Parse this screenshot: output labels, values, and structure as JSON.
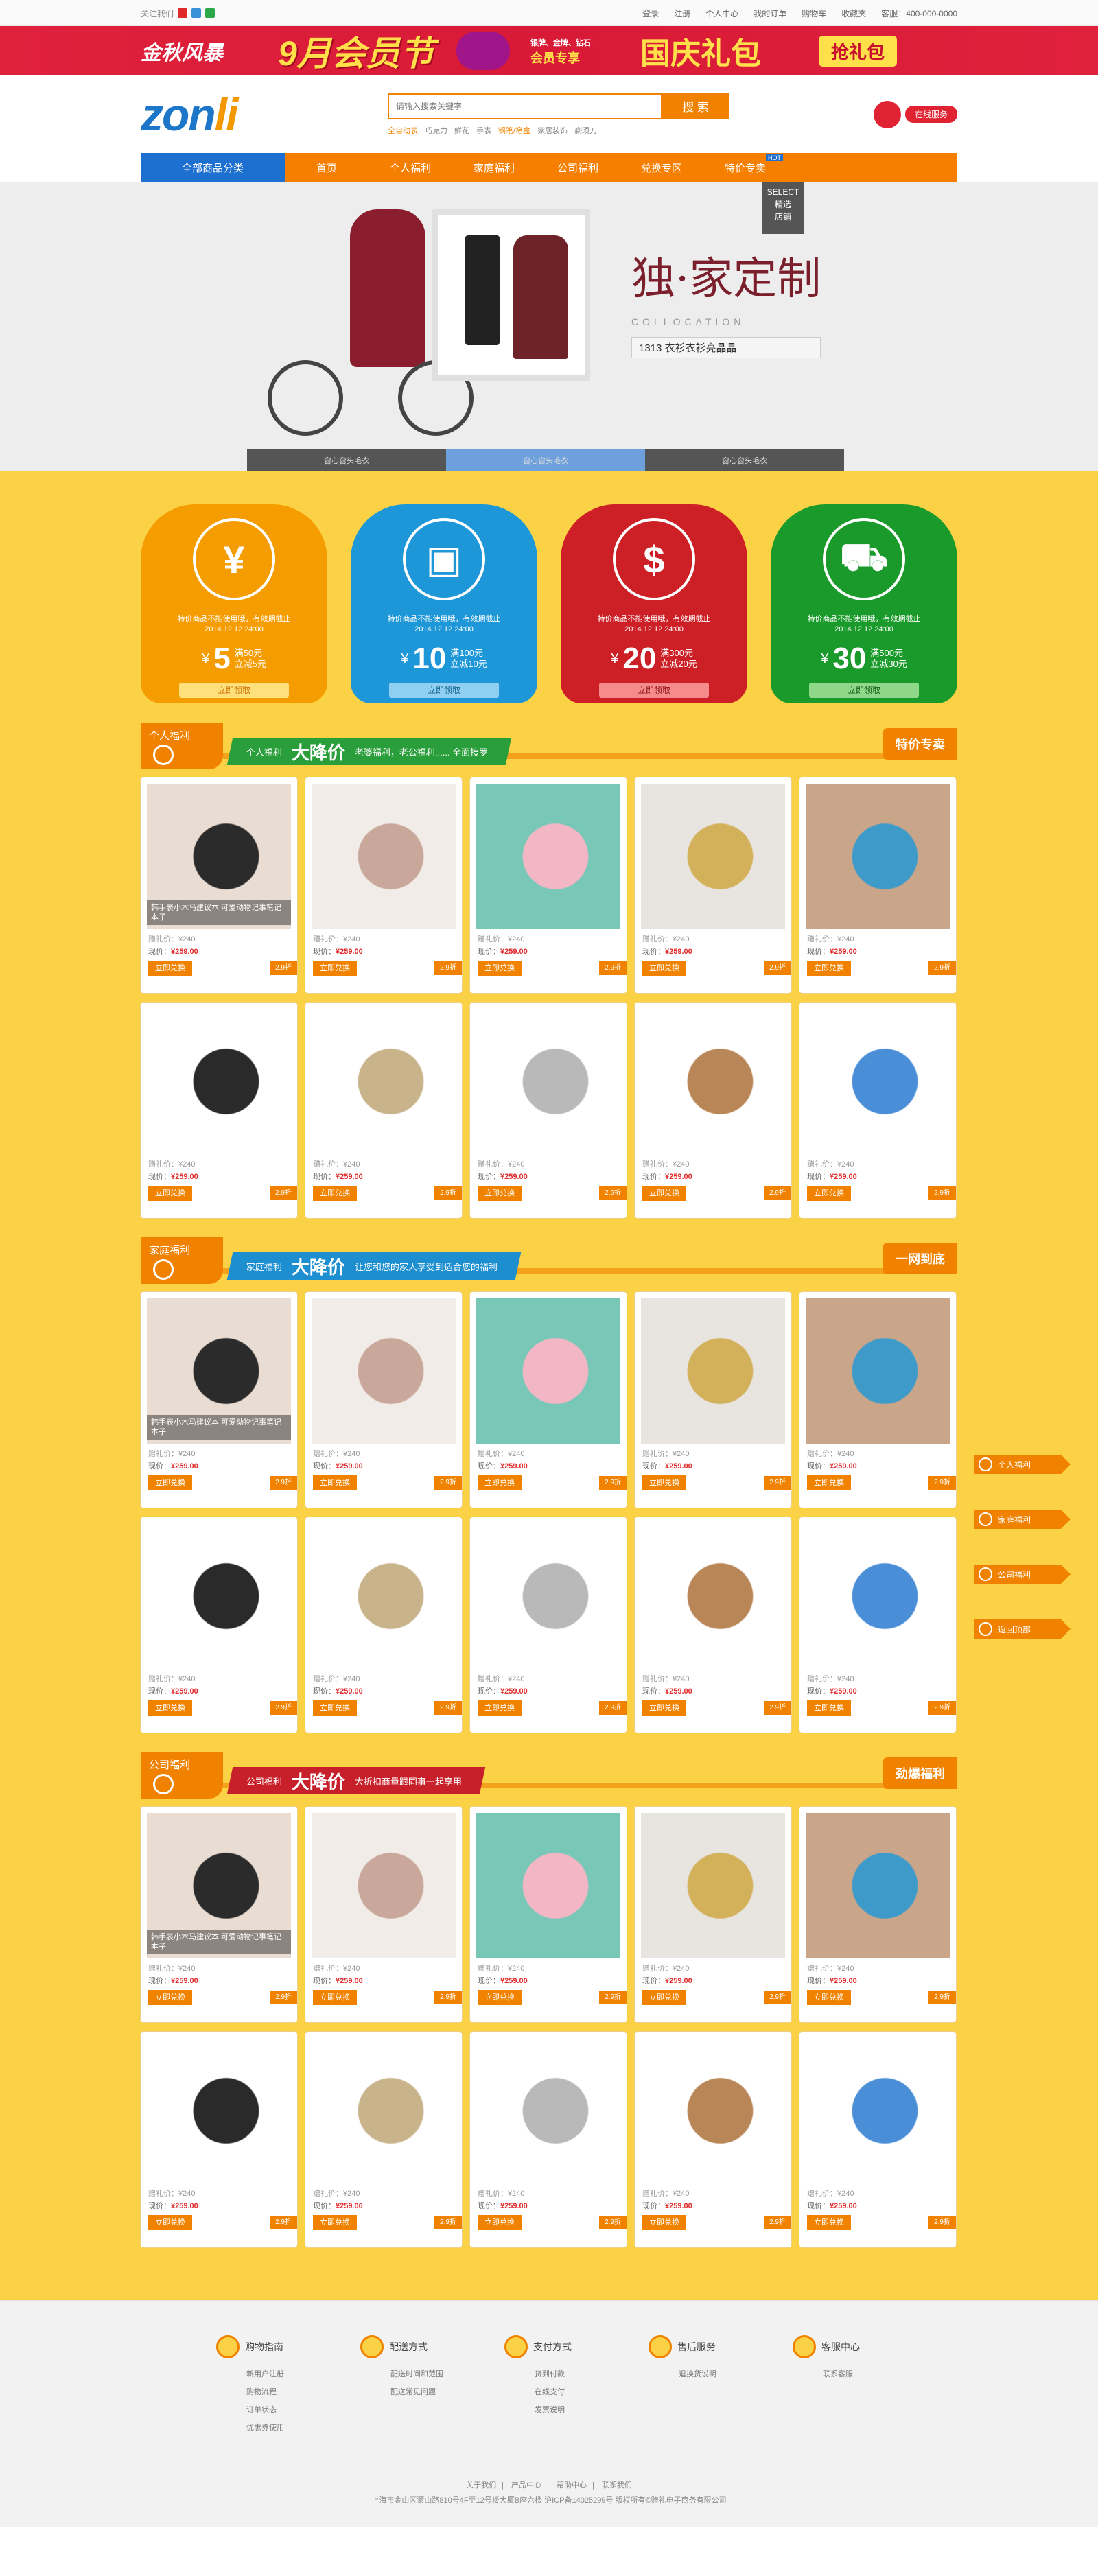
{
  "topbar": {
    "follow": "关注我们",
    "links": [
      "登录",
      "注册",
      "个人中心",
      "我的订单",
      "购物车",
      "收藏夹",
      "客服：400-000-0000"
    ]
  },
  "promo": {
    "t1": "金秋风暴",
    "t2": "9月会员节",
    "t3": "会员专享",
    "t3small": "银牌、金牌、钻石",
    "t4": "国庆礼包",
    "btn": "抢礼包"
  },
  "header": {
    "logo_a": "zon",
    "logo_b": "li",
    "search_placeholder": "请输入搜索关键字",
    "search_btn": "搜 索",
    "hot": [
      "全自动表",
      "巧克力",
      "鲜花",
      "手表",
      "钢笔/笔盒",
      "家居装饰",
      "剃须刀"
    ],
    "online": "在线服务"
  },
  "nav": {
    "all": "全部商品分类",
    "items": [
      "首页",
      "个人福利",
      "家庭福利",
      "公司福利",
      "兑换专区",
      "特价专卖"
    ],
    "hot": "HOT"
  },
  "hero": {
    "select1": "SELECT",
    "select2": "精选",
    "select3": "店铺",
    "title": "独·家定制",
    "sub": "COLLOCATION",
    "tagline": "1313 衣衫衣衫亮晶晶",
    "tabs": [
      "窗心窗头毛衣",
      "窗心窗头毛衣",
      "窗心窗头毛衣"
    ]
  },
  "coupons": [
    {
      "color": "#f49c00",
      "icon": "¥",
      "desc": "特价商品不能使用哦，有效期截止",
      "date": "2014.12.12 24:00",
      "big": "5",
      "cond1": "满50元",
      "cond2": "立减5元",
      "btn": "立即领取",
      "btnbg": "#ffe07a",
      "btncolor": "#c86d00"
    },
    {
      "color": "#1d97d8",
      "icon": "▣",
      "desc": "特价商品不能使用哦，有效期截止",
      "date": "2014.12.12 24:00",
      "big": "10",
      "cond1": "满100元",
      "cond2": "立减10元",
      "btn": "立即领取",
      "btnbg": "#8fd0f2",
      "btncolor": "#0d5f8c"
    },
    {
      "color": "#cc1f26",
      "icon": "$",
      "desc": "特价商品不能使用哦，有效期截止",
      "date": "2014.12.12 24:00",
      "big": "20",
      "cond1": "满300元",
      "cond2": "立减20元",
      "btn": "立即领取",
      "btnbg": "#f58b8b",
      "btncolor": "#8a0d12"
    },
    {
      "color": "#1a9a2a",
      "icon": "⛟",
      "desc": "特价商品不能使用哦，有效期截止",
      "date": "2014.12.12 24:00",
      "big": "30",
      "cond1": "满500元",
      "cond2": "立减30元",
      "btn": "立即领取",
      "btnbg": "#8fd88a",
      "btncolor": "#0b5a14"
    }
  ],
  "sections": [
    {
      "tag": "个人福利",
      "ribbon_label": "个人福利",
      "jj": "大降价",
      "slogan": "老婆福利，老公福利...... 全面搜罗",
      "badge": "特价专卖",
      "ribbon_color": "#2a9e3a"
    },
    {
      "tag": "家庭福利",
      "ribbon_label": "家庭福利",
      "jj": "大降价",
      "slogan": "让您和您的家人享受到适合您的福利",
      "badge": "一网到底",
      "ribbon_color": "#1d8fd0"
    },
    {
      "tag": "公司福利",
      "ribbon_label": "公司福利",
      "jj": "大降价",
      "slogan": "大折扣商量跟同事一起享用",
      "badge": "劲爆福利",
      "ribbon_color": "#c8202a"
    }
  ],
  "product_card": {
    "orig": "赠礼价：¥240",
    "price_label": "现价：",
    "price": "¥259.00",
    "btn": "立即兑换",
    "disc": "2.9折",
    "caption": "韩手表小木马建议本 可爱动物记事笔记本子"
  },
  "floatnav": [
    "个人福利",
    "家庭福利",
    "公司福利",
    "返回顶部"
  ],
  "footer": {
    "cols": [
      {
        "title": "购物指南",
        "links": [
          "新用户注册",
          "购物流程",
          "订单状态",
          "优惠券使用"
        ]
      },
      {
        "title": "配送方式",
        "links": [
          "配送时间和范围",
          "配送常见问题"
        ]
      },
      {
        "title": "支付方式",
        "links": [
          "货到付款",
          "在线支付",
          "发票说明"
        ]
      },
      {
        "title": "售后服务",
        "links": [
          "退换货说明"
        ]
      },
      {
        "title": "客服中心",
        "links": [
          "联系客服"
        ]
      }
    ],
    "bottom_links": [
      "关于我们",
      "产品中心",
      "帮助中心",
      "联系我们"
    ],
    "copyright": "上海市金山区蒙山路810号4F至12号楼大厦B座六楼 沪ICP备14025299号 版权所有©赠礼电子商务有限公司"
  }
}
